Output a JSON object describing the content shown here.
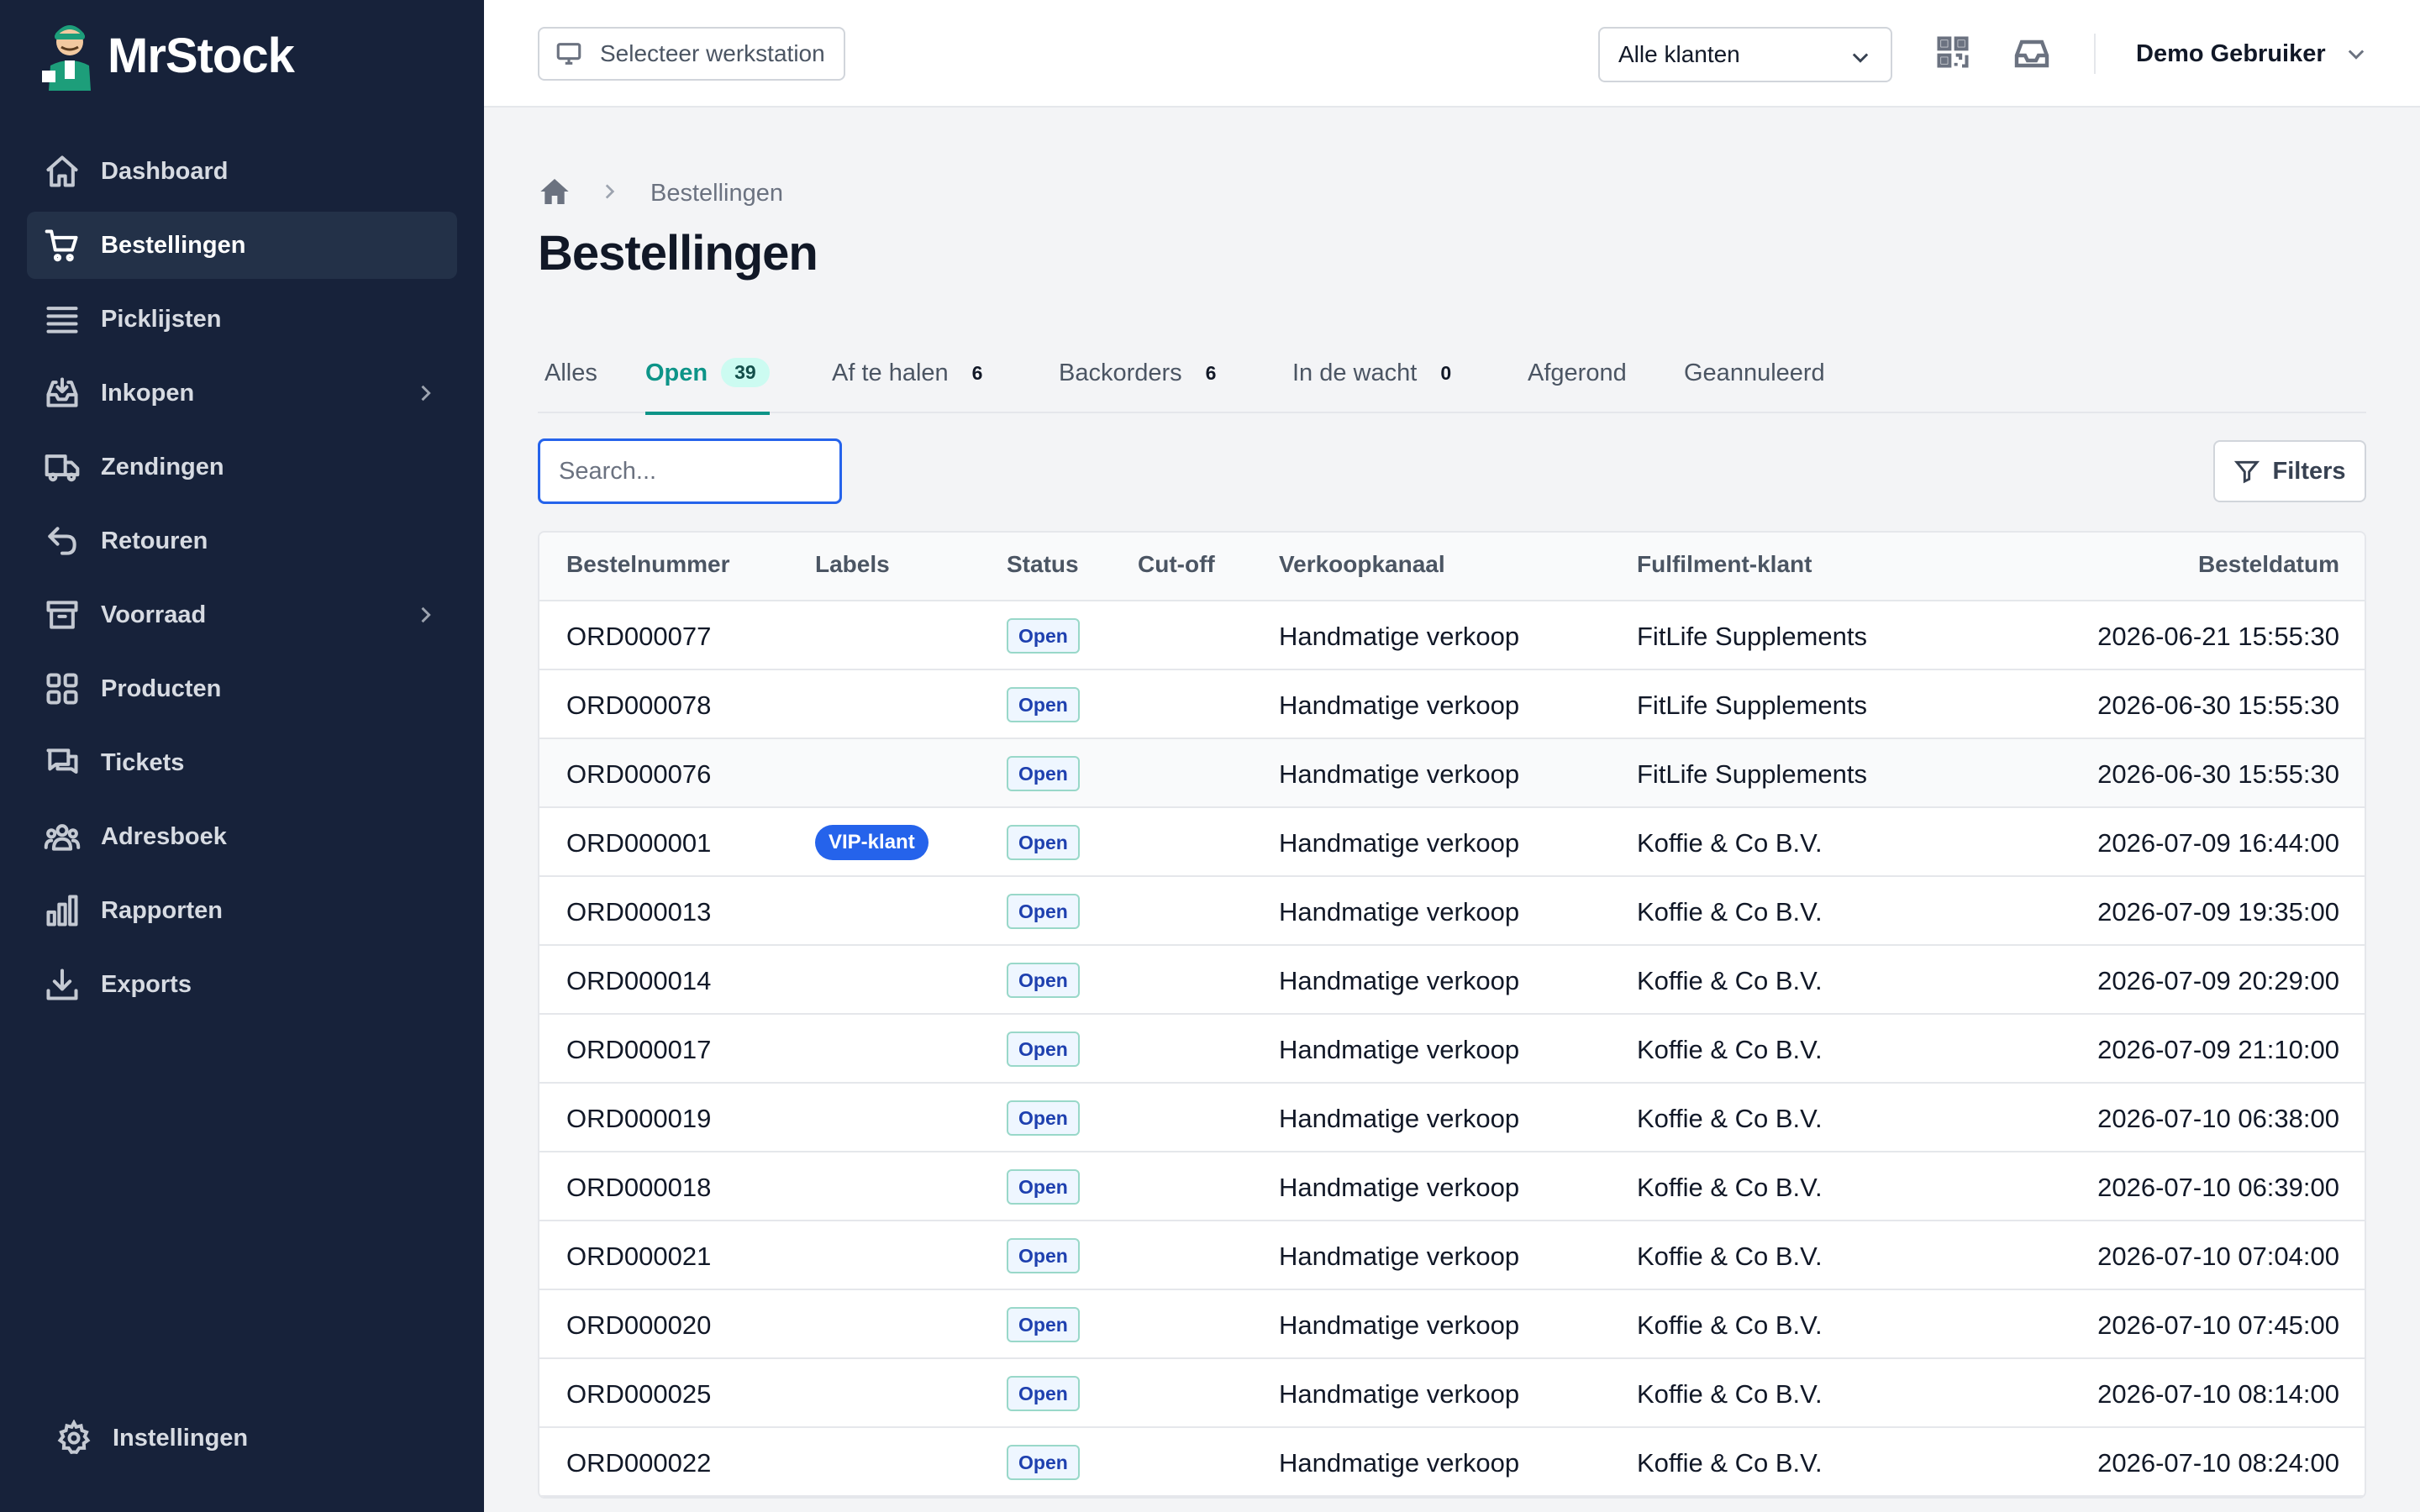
{
  "brand": {
    "name": "MrStock"
  },
  "sidebar": {
    "items": [
      {
        "label": "Dashboard",
        "icon": "home-icon"
      },
      {
        "label": "Bestellingen",
        "icon": "cart-icon",
        "active": true
      },
      {
        "label": "Picklijsten",
        "icon": "list-icon"
      },
      {
        "label": "Inkopen",
        "icon": "inbox-download-icon",
        "expandable": true
      },
      {
        "label": "Zendingen",
        "icon": "truck-icon"
      },
      {
        "label": "Retouren",
        "icon": "return-arrow-icon"
      },
      {
        "label": "Voorraad",
        "icon": "archive-box-icon",
        "expandable": true
      },
      {
        "label": "Producten",
        "icon": "grid-icon"
      },
      {
        "label": "Tickets",
        "icon": "chat-icon"
      },
      {
        "label": "Adresboek",
        "icon": "users-icon"
      },
      {
        "label": "Rapporten",
        "icon": "bar-chart-icon"
      },
      {
        "label": "Exports",
        "icon": "download-icon"
      }
    ],
    "settings_label": "Instellingen"
  },
  "topbar": {
    "workstation_label": "Selecteer werkstation",
    "client_select": "Alle klanten",
    "user_name": "Demo Gebruiker"
  },
  "breadcrumb": {
    "current": "Bestellingen"
  },
  "page": {
    "title": "Bestellingen"
  },
  "tabs": [
    {
      "label": "Alles",
      "count": ""
    },
    {
      "label": "Open",
      "count": "39",
      "active": true
    },
    {
      "label": "Af te halen",
      "count": "6"
    },
    {
      "label": "Backorders",
      "count": "6"
    },
    {
      "label": "In de wacht",
      "count": "0"
    },
    {
      "label": "Afgerond",
      "count": ""
    },
    {
      "label": "Geannuleerd",
      "count": ""
    }
  ],
  "search": {
    "placeholder": "Search..."
  },
  "filters_label": "Filters",
  "table": {
    "columns": [
      "Bestelnummer",
      "Labels",
      "Status",
      "Cut-off",
      "Verkoopkanaal",
      "Fulfilment-klant",
      "Besteldatum"
    ],
    "rows": [
      {
        "order": "ORD000077",
        "label": "",
        "status": "Open",
        "cutoff": "",
        "channel": "Handmatige verkoop",
        "client": "FitLife Supplements",
        "date": "2026-06-21 15:55:30"
      },
      {
        "order": "ORD000078",
        "label": "",
        "status": "Open",
        "cutoff": "",
        "channel": "Handmatige verkoop",
        "client": "FitLife Supplements",
        "date": "2026-06-30 15:55:30"
      },
      {
        "order": "ORD000076",
        "label": "",
        "status": "Open",
        "cutoff": "",
        "channel": "Handmatige verkoop",
        "client": "FitLife Supplements",
        "date": "2026-06-30 15:55:30"
      },
      {
        "order": "ORD000001",
        "label": "VIP-klant",
        "status": "Open",
        "cutoff": "",
        "channel": "Handmatige verkoop",
        "client": "Koffie & Co B.V.",
        "date": "2026-07-09 16:44:00"
      },
      {
        "order": "ORD000013",
        "label": "",
        "status": "Open",
        "cutoff": "",
        "channel": "Handmatige verkoop",
        "client": "Koffie & Co B.V.",
        "date": "2026-07-09 19:35:00"
      },
      {
        "order": "ORD000014",
        "label": "",
        "status": "Open",
        "cutoff": "",
        "channel": "Handmatige verkoop",
        "client": "Koffie & Co B.V.",
        "date": "2026-07-09 20:29:00"
      },
      {
        "order": "ORD000017",
        "label": "",
        "status": "Open",
        "cutoff": "",
        "channel": "Handmatige verkoop",
        "client": "Koffie & Co B.V.",
        "date": "2026-07-09 21:10:00"
      },
      {
        "order": "ORD000019",
        "label": "",
        "status": "Open",
        "cutoff": "",
        "channel": "Handmatige verkoop",
        "client": "Koffie & Co B.V.",
        "date": "2026-07-10 06:38:00"
      },
      {
        "order": "ORD000018",
        "label": "",
        "status": "Open",
        "cutoff": "",
        "channel": "Handmatige verkoop",
        "client": "Koffie & Co B.V.",
        "date": "2026-07-10 06:39:00"
      },
      {
        "order": "ORD000021",
        "label": "",
        "status": "Open",
        "cutoff": "",
        "channel": "Handmatige verkoop",
        "client": "Koffie & Co B.V.",
        "date": "2026-07-10 07:04:00"
      },
      {
        "order": "ORD000020",
        "label": "",
        "status": "Open",
        "cutoff": "",
        "channel": "Handmatige verkoop",
        "client": "Koffie & Co B.V.",
        "date": "2026-07-10 07:45:00"
      },
      {
        "order": "ORD000025",
        "label": "",
        "status": "Open",
        "cutoff": "",
        "channel": "Handmatige verkoop",
        "client": "Koffie & Co B.V.",
        "date": "2026-07-10 08:14:00"
      },
      {
        "order": "ORD000022",
        "label": "",
        "status": "Open",
        "cutoff": "",
        "channel": "Handmatige verkoop",
        "client": "Koffie & Co B.V.",
        "date": "2026-07-10 08:24:00"
      }
    ]
  },
  "colors": {
    "sidebar_bg": "#17223a",
    "accent": "#0d9488",
    "vip_badge": "#2563eb",
    "status_text": "#1e40af"
  }
}
